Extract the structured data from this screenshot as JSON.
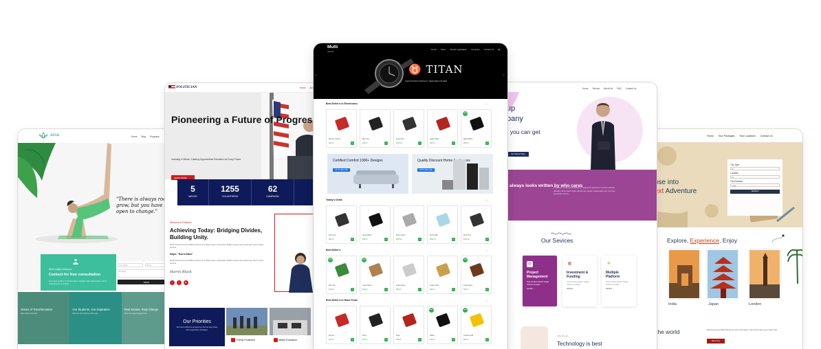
{
  "yoga": {
    "logo": "asna",
    "nav": [
      "Home",
      "Blog",
      "Programs"
    ],
    "quote": "\"There is always room to grow, but you have to be open to change.\"",
    "consult_tag": "We're ready to help you",
    "consult_title": "Contact for free consultation",
    "consult_text": "In ut justo porttitor in lobortis lacus volutpat tellus ullamcorper nisl id. Adipiscing sit in congue.",
    "form_fields": [
      "Your Name",
      "Phone",
      "Message"
    ],
    "send_label": "SEND",
    "tiles": [
      {
        "title": "Voices of Transformation",
        "text": "Real stories of growth"
      },
      {
        "title": "Our Students, Our Inspiration",
        "text": "Discover their journeys with yoga"
      },
      {
        "title": "Real Stories, Real Change",
        "text": "Hear how yoga changed lives"
      }
    ]
  },
  "politician": {
    "logo": "POLITICIAN",
    "nav": [
      "Home",
      "About"
    ],
    "hero_title": "Pioneering a Future of Progress",
    "hero_sub": "Investing in Minds, Creating Opportunities Education for Every Future",
    "hero_button": "LEARN MORE",
    "stats": [
      {
        "value": "5",
        "label": "MAYOR"
      },
      {
        "value": "1255",
        "label": "VOLUNTEERS"
      },
      {
        "value": "62",
        "label": "CAMPAIGN"
      }
    ],
    "welcome": "Welcome to Politician",
    "heading": "Achieving Today: Bridging Divides, Building Unity.",
    "body1": "Morbi lobortis cursus facilisis ultrices sem ullamcorper consectetur facilisi semper sed maecenas. Sed in tellus tempus.",
    "mayor": "Mayor, \"Harris Black\"",
    "body2": "Morbi lobortis cursus facilisis ultrices sem ullamcorper consectetur facilisi semper sed maecenas. Sed in tellus tempus.",
    "signature": "Harris Black",
    "priorities_title": "Our Priorities",
    "priorities_text": "We hold a different perspective and we stay sharp with progressive strategies.",
    "priority_labels": [
      "Family Protection",
      "Better Education"
    ]
  },
  "multivendor": {
    "logo": "Multi",
    "logo_sub": "Vendor",
    "nav": [
      "Home",
      "Shop",
      "Vendor registration",
      "Compare",
      "Contact Us"
    ],
    "banner_brand": "TITAN",
    "banner_sub": "A DESTINATION SPECIALLY DESIGNED FOR MEN",
    "sections": [
      {
        "title": "Best Seller's In Electronics",
        "products": [
          {
            "name": "Remote Control",
            "price": "$49.00",
            "color": "#c72a2a",
            "badge": ""
          },
          {
            "name": "Plier Tool",
            "price": "$29.00",
            "color": "#222",
            "badge": ""
          },
          {
            "name": "Drone Mini",
            "price": "$139.00",
            "color": "#333",
            "badge": ""
          },
          {
            "name": "Guitar Strap",
            "price": "$19.00",
            "color": "#b3261e",
            "badge": ""
          },
          {
            "name": "Wallet Black",
            "price": "$39.00",
            "color": "#111",
            "badge": "New"
          }
        ]
      },
      {
        "title": "Today's Deals",
        "products": [
          {
            "name": "Drone Kit",
            "price": "$99.00",
            "color": "#333",
            "badge": ""
          },
          {
            "name": "Smart Watch",
            "price": "$59.00",
            "color": "#111",
            "badge": ""
          },
          {
            "name": "Phone Silver",
            "price": "$499.00",
            "color": "#aaa",
            "badge": ""
          },
          {
            "name": "Phone Blue",
            "price": "$399.00",
            "color": "#a8d8e8",
            "badge": ""
          },
          {
            "name": "Drone Pro",
            "price": "$159.00",
            "color": "#333",
            "badge": ""
          }
        ]
      },
      {
        "title": "Best Seller's",
        "products": [
          {
            "name": "Plant Pot",
            "price": "$15.00",
            "color": "#3a8a3a",
            "badge": "Sale"
          },
          {
            "name": "Cupid Statue",
            "price": "$45.00",
            "color": "#b08050",
            "badge": "Sale"
          },
          {
            "name": "Angel Figure",
            "price": "$35.00",
            "color": "#ccc",
            "badge": ""
          },
          {
            "name": "Teapot Gold",
            "price": "$25.00",
            "color": "#c9a14a",
            "badge": ""
          },
          {
            "name": "Tribal Statue",
            "price": "$55.00",
            "color": "#6b3a1f",
            "badge": "Sale"
          }
        ]
      },
      {
        "title": "Best Seller's In Hand Tools",
        "products": [
          {
            "name": "Remote",
            "price": "$49.00",
            "color": "#c72a2a",
            "badge": ""
          },
          {
            "name": "Pliers",
            "price": "$29.00",
            "color": "#222",
            "badge": ""
          },
          {
            "name": "Strap",
            "price": "$19.00",
            "color": "#b3261e",
            "badge": ""
          },
          {
            "name": "Wallet",
            "price": "$39.00",
            "color": "#111",
            "badge": "New"
          },
          {
            "name": "Cordless Drill",
            "price": "$89.00",
            "color": "#f2c200",
            "badge": "New"
          }
        ]
      }
    ],
    "promos": [
      {
        "title": "Certified Comfort 1000+ Designs",
        "tag": "UP TO 40% OFF"
      },
      {
        "title": "Quality Discount Home Appliances",
        "tag": "UP TO 60% OFF"
      }
    ]
  },
  "business": {
    "nav": [
      "Home",
      "Service",
      "About Us",
      "FAQ",
      "Contact Us"
    ],
    "hero_lines": [
      "up",
      "pany",
      "t you can get"
    ],
    "hero_button": "Get Started Today",
    "band_title": "t always looks written by who cares",
    "band_text": "Porta sem in laoreet penatibus et magnis dis parturient montes nascetur ridiculus. Mus mauris vitae ultricies leo integer malesuada nunc vel risus commodo viverra.",
    "services_title": "Our Sevices",
    "services": [
      {
        "title": "Project Management",
        "text": "Cras tincidunt lobortis feugiat vivamus at augue.",
        "more": "LEARN →",
        "icon": "lightbulb-icon",
        "active": true
      },
      {
        "title": "Investment & Funding",
        "text": "Cras tincidunt lobortis feugiat vivamus at augue.",
        "more": "LEARN →",
        "icon": "chart-icon",
        "active": false
      },
      {
        "title": "Multiple Platform",
        "text": "Cras tincidunt lobortis feugiat vivamus at augue.",
        "more": "LEARN →",
        "icon": "snowflake-icon",
        "active": false
      }
    ],
    "who": "Who We Are",
    "tech": "Technology is best"
  },
  "travel": {
    "nav": [
      "Home",
      "Tour Packages",
      "Tour Locations",
      "Contact Us"
    ],
    "hero_pre": "pse into",
    "hero_accent": "ext",
    "hero_post": " Adventure",
    "booking": {
      "labels": [
        "Trip Type",
        "Location",
        "Trip Duration"
      ],
      "values": [
        "All",
        "All",
        "1 Day"
      ],
      "search": "SEARCH"
    },
    "explore_pre": "Explore, ",
    "explore_accent": "Experience",
    "explore_post": ", Enjoy",
    "cities": [
      "India",
      "Japan",
      "London"
    ],
    "world": "the world",
    "world_text": "We're giving a 20% discount if you book early. Hurry and save your spot now!",
    "world_button": "Book Now"
  }
}
